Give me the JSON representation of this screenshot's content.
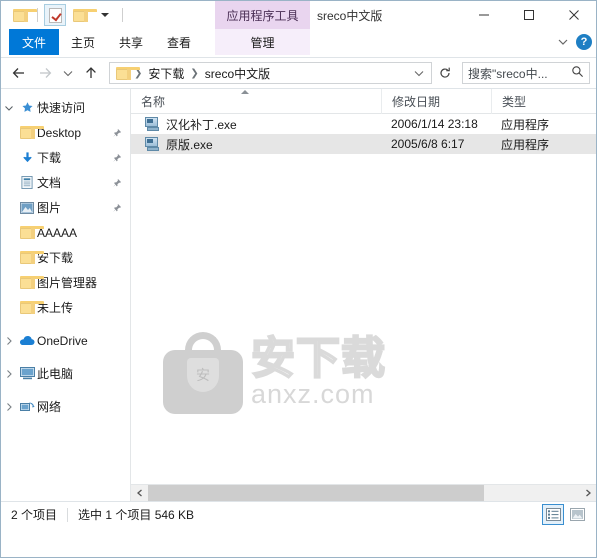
{
  "titlebar": {
    "quick_access": [
      {
        "name": "folder-icon",
        "label": "文件夹"
      },
      {
        "name": "properties-icon",
        "label": "属性"
      },
      {
        "name": "new-folder-icon",
        "label": "新建文件夹"
      },
      {
        "name": "customize-dropdown",
        "label": "自定义快速访问工具栏"
      }
    ],
    "contextual_group": "应用程序工具",
    "window_title": "sreco中文版",
    "minimize": "—",
    "maximize": "▢",
    "close": "✕"
  },
  "ribbon": {
    "tabs": [
      {
        "label": "文件",
        "active": true
      },
      {
        "label": "主页",
        "active": false
      },
      {
        "label": "共享",
        "active": false
      },
      {
        "label": "查看",
        "active": false
      }
    ],
    "contextual_tab": "管理",
    "collapse_label": "∨",
    "help_label": "?"
  },
  "address": {
    "back": "←",
    "forward": "→",
    "history": "∨",
    "up": "↑",
    "breadcrumbs": [
      "安下载",
      "sreco中文版"
    ],
    "breadcrumb_dropdown": "∨",
    "refresh": "↻"
  },
  "search": {
    "placeholder": "搜索\"sreco中...",
    "icon": "search-icon"
  },
  "sidebar": {
    "items": [
      {
        "label": "快速访问",
        "icon": "star-icon",
        "expander": "∨",
        "indent": 0,
        "pin": false
      },
      {
        "label": "Desktop",
        "icon": "folder-icon",
        "expander": "",
        "indent": 1,
        "pin": true
      },
      {
        "label": "下载",
        "icon": "download-icon",
        "expander": "",
        "indent": 1,
        "pin": true
      },
      {
        "label": "文档",
        "icon": "documents-icon",
        "expander": "",
        "indent": 1,
        "pin": true
      },
      {
        "label": "图片",
        "icon": "pictures-icon",
        "expander": "",
        "indent": 1,
        "pin": true
      },
      {
        "label": "AAAAA",
        "icon": "folder-icon",
        "expander": "",
        "indent": 1,
        "pin": false
      },
      {
        "label": "安下载",
        "icon": "folder-icon",
        "expander": "",
        "indent": 1,
        "pin": false
      },
      {
        "label": "图片管理器",
        "icon": "folder-icon",
        "expander": "",
        "indent": 1,
        "pin": false
      },
      {
        "label": "未上传",
        "icon": "folder-icon",
        "expander": "",
        "indent": 1,
        "pin": false
      },
      {
        "label": "OneDrive",
        "icon": "cloud-icon",
        "expander": "›",
        "indent": 0,
        "pin": false
      },
      {
        "label": "此电脑",
        "icon": "computer-icon",
        "expander": "›",
        "indent": 0,
        "pin": false
      },
      {
        "label": "网络",
        "icon": "network-icon",
        "expander": "›",
        "indent": 0,
        "pin": false
      }
    ]
  },
  "filelist": {
    "columns": [
      {
        "label": "名称",
        "sorted": true
      },
      {
        "label": "修改日期",
        "sorted": false
      },
      {
        "label": "类型",
        "sorted": false
      }
    ],
    "rows": [
      {
        "name": "汉化补丁.exe",
        "date": "2006/1/14 23:18",
        "type": "应用程序",
        "selected": false
      },
      {
        "name": "原版.exe",
        "date": "2005/6/8 6:17",
        "type": "应用程序",
        "selected": true
      }
    ]
  },
  "watermark": {
    "logo_char": "安",
    "cn_text": "安下载",
    "en_text": "anxz.com"
  },
  "statusbar": {
    "item_count": "2 个项目",
    "selection": "选中 1 个项目  546 KB",
    "views": [
      {
        "name": "details-view-button",
        "active": true
      },
      {
        "name": "large-icons-view-button",
        "active": false
      }
    ]
  },
  "colors": {
    "accent": "#0078d7",
    "contextual": "#e9d5ef",
    "selection": "#e6e6e6"
  }
}
